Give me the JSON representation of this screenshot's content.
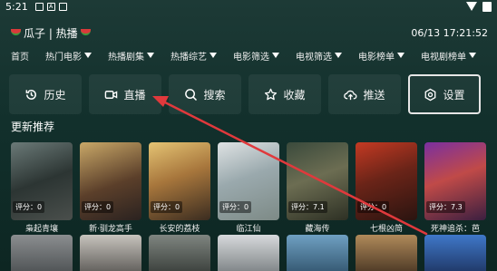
{
  "status": {
    "time": "5:21",
    "icon_a": "A"
  },
  "header": {
    "title": "瓜子 | 热播",
    "datetime": "06/13 17:21:52"
  },
  "filters": [
    {
      "label": "首页",
      "funnel": false
    },
    {
      "label": "热门电影",
      "funnel": true
    },
    {
      "label": "热播剧集",
      "funnel": true
    },
    {
      "label": "热播综艺",
      "funnel": true
    },
    {
      "label": "电影筛选",
      "funnel": true
    },
    {
      "label": "电视筛选",
      "funnel": true
    },
    {
      "label": "电影榜单",
      "funnel": true
    },
    {
      "label": "电视剧榜单",
      "funnel": true
    }
  ],
  "actions": {
    "history": "历史",
    "live": "直播",
    "search": "搜索",
    "favorite": "收藏",
    "push": "推送",
    "settings": "设置"
  },
  "section_title": "更新推荐",
  "cards": [
    {
      "title": "枭起青壤",
      "rating": "评分：0"
    },
    {
      "title": "新·驯龙高手",
      "rating": "评分：0"
    },
    {
      "title": "长安的荔枝",
      "rating": "评分：0"
    },
    {
      "title": "临江仙",
      "rating": "评分：0"
    },
    {
      "title": "藏海传",
      "rating": "评分：7.1"
    },
    {
      "title": "七根凶简",
      "rating": "评分：0"
    },
    {
      "title": "死神追杀：芭",
      "rating": "评分：7.3"
    }
  ],
  "colors": {
    "accent_arrow": "#e0393c",
    "background": "#16332f"
  }
}
